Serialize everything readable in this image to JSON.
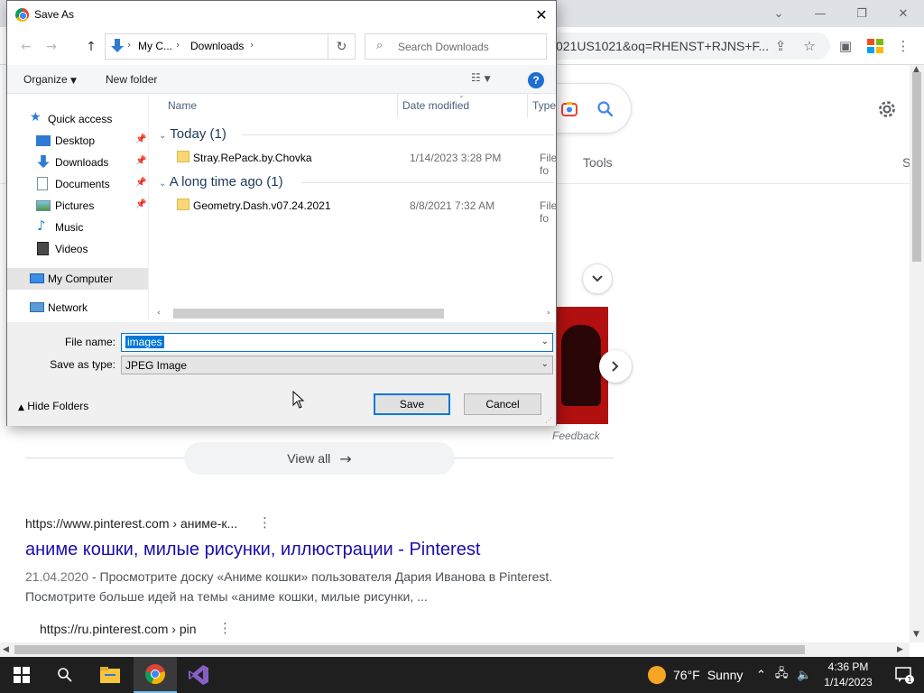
{
  "browser": {
    "url_fragment": "021US1021&oq=RHENST+RJNS+F...",
    "tools_label": "Tools",
    "s_fragment": "S",
    "feedback": "Feedback",
    "view_all": "View all",
    "result1": {
      "url": "https://www.pinterest.com › аниме-к...",
      "title": "аниме кошки, милые рисунки, иллюстрации - Pinterest",
      "date": "21.04.2020",
      "snippet": " - Просмотрите доску «Аниме кошки» пользователя Дария Иванова в Pinterest. Посмотрите больше идей на темы «аниме кошки, милые рисунки, ..."
    },
    "result2": {
      "url": "https://ru.pinterest.com › pin"
    }
  },
  "dialog": {
    "title": "Save As",
    "address": {
      "crumb1": "My C...",
      "crumb2": "Downloads"
    },
    "search_placeholder": "Search Downloads",
    "organize": "Organize",
    "new_folder": "New folder",
    "help": "?",
    "nav": {
      "quick_access": "Quick access",
      "desktop": "Desktop",
      "downloads": "Downloads",
      "documents": "Documents",
      "pictures": "Pictures",
      "music": "Music",
      "videos": "Videos",
      "my_computer": "My Computer",
      "network": "Network"
    },
    "columns": {
      "name": "Name",
      "date": "Date modified",
      "type": "Type"
    },
    "groups": [
      {
        "label": "Today (1)",
        "files": [
          {
            "name": "Stray.RePack.by.Chovka",
            "date": "1/14/2023 3:28 PM",
            "type": "File fo"
          }
        ]
      },
      {
        "label": "A long time ago (1)",
        "files": [
          {
            "name": "Geometry.Dash.v07.24.2021",
            "date": "8/8/2021 7:32 AM",
            "type": "File fo"
          }
        ]
      }
    ],
    "file_name_label": "File name:",
    "file_name_value": "images",
    "save_type_label": "Save as type:",
    "save_type_value": "JPEG Image",
    "hide_folders": "Hide Folders",
    "save": "Save",
    "cancel": "Cancel"
  },
  "taskbar": {
    "weather_temp": "76°F",
    "weather_text": "Sunny",
    "time": "4:36 PM",
    "date": "1/14/2023",
    "notifications": "1"
  },
  "colors": {
    "accent": "#0078d7",
    "link": "#1a0dab",
    "folder": "#f8d775"
  }
}
